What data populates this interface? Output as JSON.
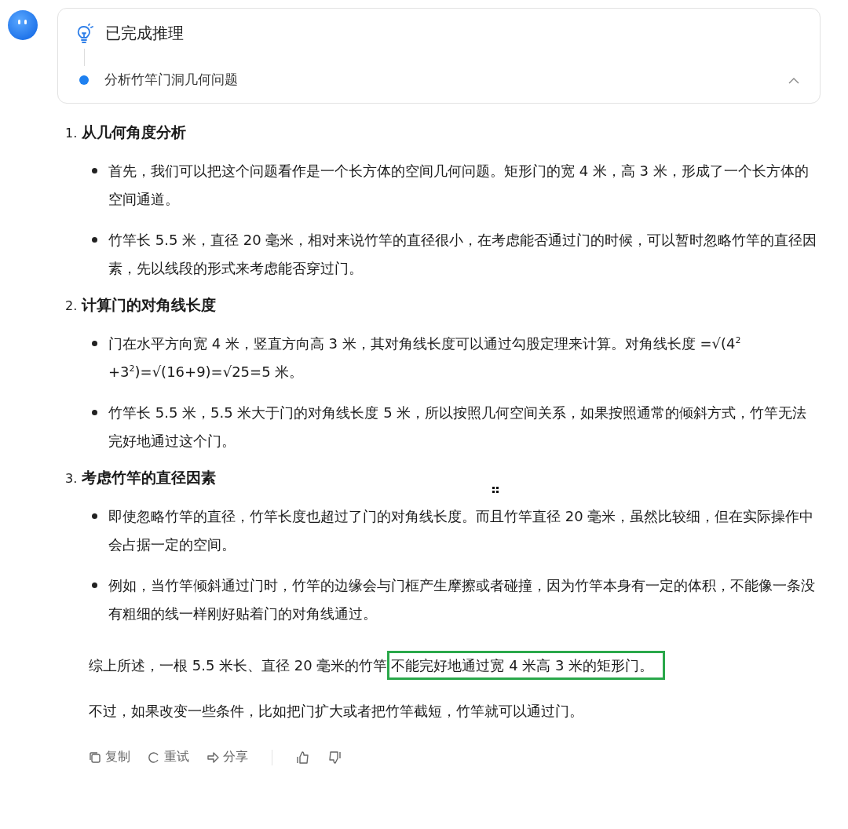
{
  "reasoning": {
    "title": "已完成推理",
    "step": "分析竹竿门洞几何问题",
    "expanded": true
  },
  "sections": [
    {
      "number": "1.",
      "heading": "从几何角度分析",
      "bullets": [
        "首先，我们可以把这个问题看作是一个长方体的空间几何问题。矩形门的宽 4 米，高 3 米，形成了一个长方体的空间通道。",
        "竹竿长 5.5 米，直径 20 毫米，相对来说竹竿的直径很小，在考虑能否通过门的时候，可以暂时忽略竹竿的直径因素，先以线段的形式来考虑能否穿过门。"
      ]
    },
    {
      "number": "2.",
      "heading": "计算门的对角线长度",
      "bullets": [
        "门在水平方向宽 4 米，竖直方向高 3 米，其对角线长度可以通过勾股定理来计算。对角线长度 =√(4$^{2}$ +3$^{2}$)=√(16+9)=√25=5 米。",
        "竹竿长 5.5 米，5.5 米大于门的对角线长度 5 米，所以按照几何空间关系，如果按照通常的倾斜方式，竹竿无法完好地通过这个门。"
      ]
    },
    {
      "number": "3.",
      "heading": "考虑竹竿的直径因素",
      "bullets": [
        "即使忽略竹竿的直径，竹竿长度也超过了门的对角线长度。而且竹竿直径 20 毫米，虽然比较细，但在实际操作中会占据一定的空间。",
        "例如，当竹竿倾斜通过门时，竹竿的边缘会与门框产生摩擦或者碰撞，因为竹竿本身有一定的体积，不能像一条没有粗细的线一样刚好贴着门的对角线通过。"
      ]
    }
  ],
  "conclusion": {
    "text": "综上所述，一根 5.5 米长、直径 20 毫米的竹竿",
    "highlighted": "不能完好地通过宽 4 米高 3 米的矩形门。"
  },
  "closing": "不过，如果改变一些条件，比如把门扩大或者把竹竿截短，竹竿就可以通过门。",
  "actions": [
    {
      "kind": "copy",
      "label": "复制"
    },
    {
      "kind": "retry",
      "label": "重试"
    },
    {
      "kind": "share",
      "label": "分享"
    }
  ],
  "feedback": [
    {
      "kind": "like"
    },
    {
      "kind": "dislike"
    }
  ]
}
